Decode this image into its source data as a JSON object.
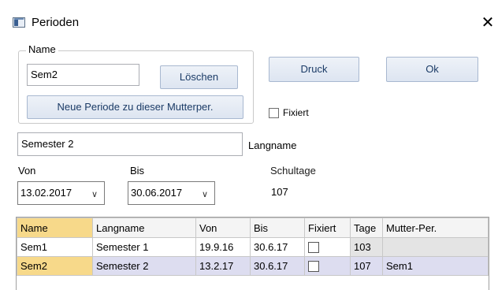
{
  "window": {
    "title": "Perioden",
    "close_glyph": "✕"
  },
  "group": {
    "legend": "Name"
  },
  "name_field": {
    "value": "Sem2"
  },
  "buttons": {
    "loeschen": "Löschen",
    "neue_periode": "Neue Periode zu dieser Mutterper.",
    "druck": "Druck",
    "ok": "Ok"
  },
  "fixiert": {
    "label": "Fixiert",
    "checked": false
  },
  "langname": {
    "value": "Semester 2",
    "label": "Langname"
  },
  "von": {
    "label": "Von",
    "value": "13.02.2017"
  },
  "bis": {
    "label": "Bis",
    "value": "30.06.2017"
  },
  "schultage": {
    "label": "Schultage",
    "value": "107"
  },
  "table": {
    "headers": [
      "Name",
      "Langname",
      "Von",
      "Bis",
      "Fixiert",
      "Tage",
      "Mutter-Per."
    ],
    "rows": [
      {
        "name": "Sem1",
        "langname": "Semester 1",
        "von": "19.9.16",
        "bis": "30.6.17",
        "fixiert": false,
        "tage": "103",
        "mutter": ""
      },
      {
        "name": "Sem2",
        "langname": "Semester 2",
        "von": "13.2.17",
        "bis": "30.6.17",
        "fixiert": false,
        "tage": "107",
        "mutter": "Sem1"
      }
    ]
  },
  "icons": {
    "app": "window-app-icon",
    "close": "close-icon",
    "dropdown": "chevron-down-icon"
  }
}
